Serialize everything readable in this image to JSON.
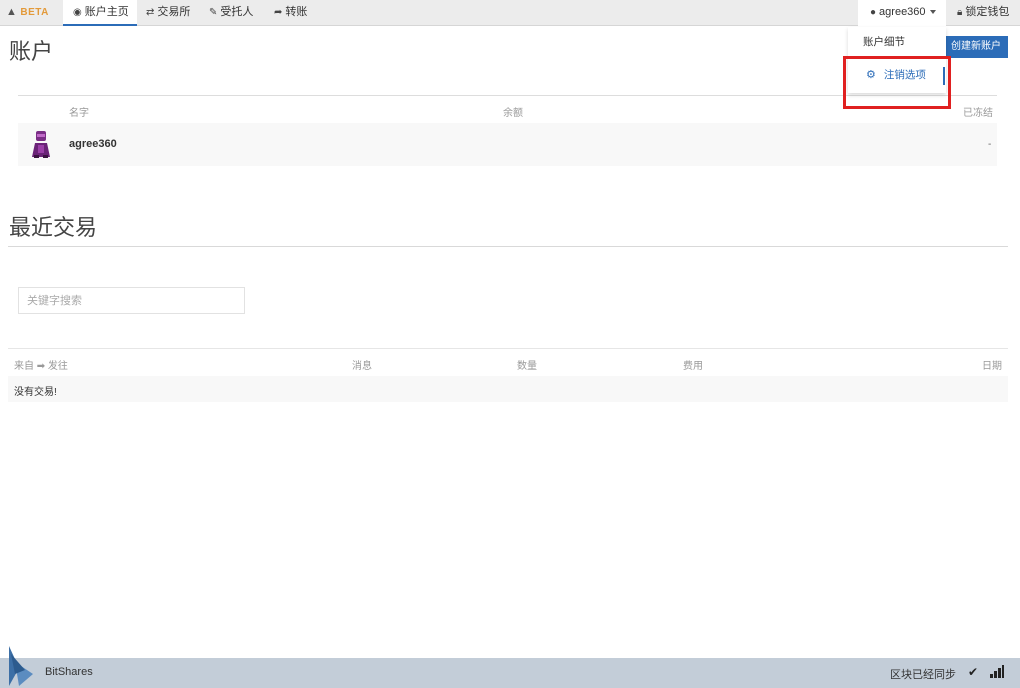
{
  "nav": {
    "beta": "BETA",
    "home": "账户主页",
    "exchange": "交易所",
    "proxy": "受托人",
    "transfer": "转账",
    "account": "agree360",
    "lock": "锁定钱包"
  },
  "dropdown": {
    "details": "账户细节",
    "settings": "注销选项"
  },
  "accounts": {
    "title": "账户",
    "create_button": "创建新账户",
    "columns": {
      "name": "名字",
      "balance": "余额",
      "locked": "已冻结"
    },
    "rows": [
      {
        "name": "agree360",
        "locked": "-"
      }
    ]
  },
  "recent": {
    "title": "最近交易",
    "search_placeholder": "关键字搜索",
    "columns": {
      "from_to": "来自 ➡ 发往",
      "message": "消息",
      "amount": "数量",
      "fee": "费用",
      "date": "日期"
    },
    "empty": "没有交易!"
  },
  "footer": {
    "brand": "BitShares",
    "sync": "区块已经同步"
  },
  "colors": {
    "accent": "#2b6cb8",
    "highlight": "#e02020",
    "footer_bg": "#c3cdd8"
  },
  "icons": {
    "beta": "warning-icon",
    "home": "dashboard-icon",
    "exchange": "exchange-arrows-icon",
    "proxy": "gavel-icon",
    "transfer": "share-arrow-icon",
    "account": "user-icon",
    "lock": "lock-icon",
    "settings": "gear-icon",
    "sync": "check-icon",
    "signal": "signal-bars-icon"
  }
}
